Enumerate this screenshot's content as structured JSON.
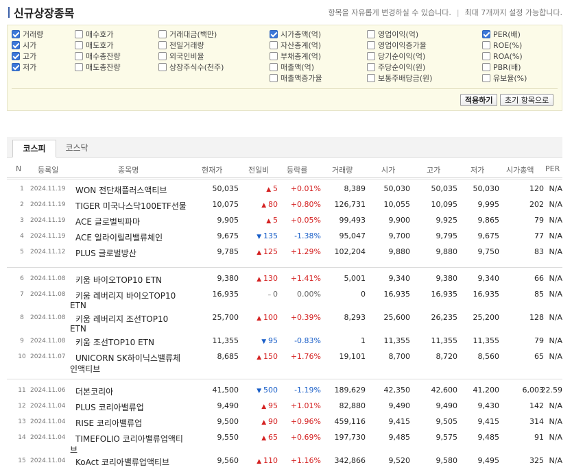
{
  "header": {
    "title": "신규상장종목",
    "desc1": "항목을 자유롭게 변경하실 수 있습니다.",
    "desc2": "최대 7개까지 설정 가능합니다."
  },
  "options": {
    "col1": [
      {
        "label": "거래량",
        "checked": true
      },
      {
        "label": "시가",
        "checked": true
      },
      {
        "label": "고가",
        "checked": true
      },
      {
        "label": "저가",
        "checked": true
      }
    ],
    "col2": [
      {
        "label": "매수호가",
        "checked": false
      },
      {
        "label": "매도호가",
        "checked": false
      },
      {
        "label": "매수총잔량",
        "checked": false
      },
      {
        "label": "매도총잔량",
        "checked": false
      }
    ],
    "col3": [
      {
        "label": "거래대금(백만)",
        "checked": false
      },
      {
        "label": "전일거래량",
        "checked": false
      },
      {
        "label": "외국인비율",
        "checked": false
      },
      {
        "label": "상장주식수(천주)",
        "checked": false
      }
    ],
    "col4": [
      {
        "label": "시가총액(억)",
        "checked": true
      },
      {
        "label": "자산총계(억)",
        "checked": false
      },
      {
        "label": "부채총계(억)",
        "checked": false
      },
      {
        "label": "매출액(억)",
        "checked": false
      },
      {
        "label": "매출액증가율",
        "checked": false
      }
    ],
    "col5": [
      {
        "label": "영업이익(억)",
        "checked": false
      },
      {
        "label": "영업이익증가율",
        "checked": false
      },
      {
        "label": "당기순이익(억)",
        "checked": false
      },
      {
        "label": "주당순이익(원)",
        "checked": false
      },
      {
        "label": "보통주배당금(원)",
        "checked": false
      }
    ],
    "col6": [
      {
        "label": "PER(배)",
        "checked": true
      },
      {
        "label": "ROE(%)",
        "checked": false
      },
      {
        "label": "ROA(%)",
        "checked": false
      },
      {
        "label": "PBR(배)",
        "checked": false
      },
      {
        "label": "유보율(%)",
        "checked": false
      }
    ],
    "apply_label": "적용하기",
    "reset_label": "초기 항목으로"
  },
  "tabs": [
    "코스피",
    "코스닥"
  ],
  "columns": [
    "N",
    "등록일",
    "종목명",
    "현재가",
    "전일비",
    "등락률",
    "거래량",
    "시가",
    "고가",
    "저가",
    "시가총액",
    "PER"
  ],
  "rows": [
    {
      "n": "1",
      "date": "2024.11.19",
      "name": "WON 전단채플러스액티브",
      "name2": "",
      "price": "50,035",
      "dir": "up",
      "chg": "5",
      "rate": "+0.01%",
      "vol": "8,389",
      "open": "50,030",
      "high": "50,035",
      "low": "50,030",
      "cap": "120",
      "per": "N/A"
    },
    {
      "n": "2",
      "date": "2024.11.19",
      "name": "TIGER 미국나스닥100ETF선물",
      "name2": "",
      "price": "10,075",
      "dir": "up",
      "chg": "80",
      "rate": "+0.80%",
      "vol": "126,731",
      "open": "10,055",
      "high": "10,095",
      "low": "9,995",
      "cap": "202",
      "per": "N/A"
    },
    {
      "n": "3",
      "date": "2024.11.19",
      "name": "ACE 글로벌빅파마",
      "name2": "",
      "price": "9,905",
      "dir": "up",
      "chg": "5",
      "rate": "+0.05%",
      "vol": "99,493",
      "open": "9,900",
      "high": "9,925",
      "low": "9,865",
      "cap": "79",
      "per": "N/A"
    },
    {
      "n": "4",
      "date": "2024.11.19",
      "name": "ACE 일라이릴리밸류체인",
      "name2": "",
      "price": "9,675",
      "dir": "down",
      "chg": "135",
      "rate": "-1.38%",
      "vol": "95,047",
      "open": "9,700",
      "high": "9,795",
      "low": "9,675",
      "cap": "77",
      "per": "N/A"
    },
    {
      "n": "5",
      "date": "2024.11.12",
      "name": "PLUS 글로벌방산",
      "name2": "",
      "price": "9,785",
      "dir": "up",
      "chg": "125",
      "rate": "+1.29%",
      "vol": "102,204",
      "open": "9,880",
      "high": "9,880",
      "low": "9,750",
      "cap": "83",
      "per": "N/A"
    },
    {
      "n": "6",
      "date": "2024.11.08",
      "name": "키움 바이오TOP10 ETN",
      "name2": "",
      "price": "9,380",
      "dir": "up",
      "chg": "130",
      "rate": "+1.41%",
      "vol": "5,001",
      "open": "9,340",
      "high": "9,380",
      "low": "9,340",
      "cap": "66",
      "per": "N/A"
    },
    {
      "n": "7",
      "date": "2024.11.08",
      "name": "키움 레버리지 바이오TOP10",
      "name2": "ETN",
      "price": "16,935",
      "dir": "flat",
      "chg": "0",
      "rate": "0.00%",
      "vol": "0",
      "open": "16,935",
      "high": "16,935",
      "low": "16,935",
      "cap": "85",
      "per": "N/A"
    },
    {
      "n": "8",
      "date": "2024.11.08",
      "name": "키움 레버리지 조선TOP10",
      "name2": "ETN",
      "price": "25,700",
      "dir": "up",
      "chg": "100",
      "rate": "+0.39%",
      "vol": "8,293",
      "open": "25,600",
      "high": "26,235",
      "low": "25,200",
      "cap": "128",
      "per": "N/A"
    },
    {
      "n": "9",
      "date": "2024.11.08",
      "name": "키움 조선TOP10 ETN",
      "name2": "",
      "price": "11,355",
      "dir": "down",
      "chg": "95",
      "rate": "-0.83%",
      "vol": "1",
      "open": "11,355",
      "high": "11,355",
      "low": "11,355",
      "cap": "79",
      "per": "N/A"
    },
    {
      "n": "10",
      "date": "2024.11.07",
      "name": "UNICORN SK하이닉스밸류체",
      "name2": "인액티브",
      "price": "8,685",
      "dir": "up",
      "chg": "150",
      "rate": "+1.76%",
      "vol": "19,101",
      "open": "8,700",
      "high": "8,720",
      "low": "8,560",
      "cap": "65",
      "per": "N/A"
    },
    {
      "n": "11",
      "date": "2024.11.06",
      "name": "더본코리아",
      "name2": "",
      "price": "41,500",
      "dir": "down",
      "chg": "500",
      "rate": "-1.19%",
      "vol": "189,629",
      "open": "42,350",
      "high": "42,600",
      "low": "41,200",
      "cap": "6,003",
      "per": "22.59"
    },
    {
      "n": "12",
      "date": "2024.11.04",
      "name": "PLUS 코리아밸류업",
      "name2": "",
      "price": "9,490",
      "dir": "up",
      "chg": "95",
      "rate": "+1.01%",
      "vol": "82,880",
      "open": "9,490",
      "high": "9,490",
      "low": "9,430",
      "cap": "142",
      "per": "N/A"
    },
    {
      "n": "13",
      "date": "2024.11.04",
      "name": "RISE 코리아밸류업",
      "name2": "",
      "price": "9,500",
      "dir": "up",
      "chg": "90",
      "rate": "+0.96%",
      "vol": "459,116",
      "open": "9,415",
      "high": "9,505",
      "low": "9,415",
      "cap": "314",
      "per": "N/A"
    },
    {
      "n": "14",
      "date": "2024.11.04",
      "name": "TIMEFOLIO 코리아밸류업액티",
      "name2": "브",
      "price": "9,550",
      "dir": "up",
      "chg": "65",
      "rate": "+0.69%",
      "vol": "197,730",
      "open": "9,485",
      "high": "9,575",
      "low": "9,485",
      "cap": "91",
      "per": "N/A"
    },
    {
      "n": "15",
      "date": "2024.11.04",
      "name": "KoAct 코리아밸류업액티브",
      "name2": "",
      "price": "9,560",
      "dir": "up",
      "chg": "110",
      "rate": "+1.16%",
      "vol": "342,866",
      "open": "9,520",
      "high": "9,580",
      "low": "9,495",
      "cap": "325",
      "per": "N/A"
    }
  ]
}
